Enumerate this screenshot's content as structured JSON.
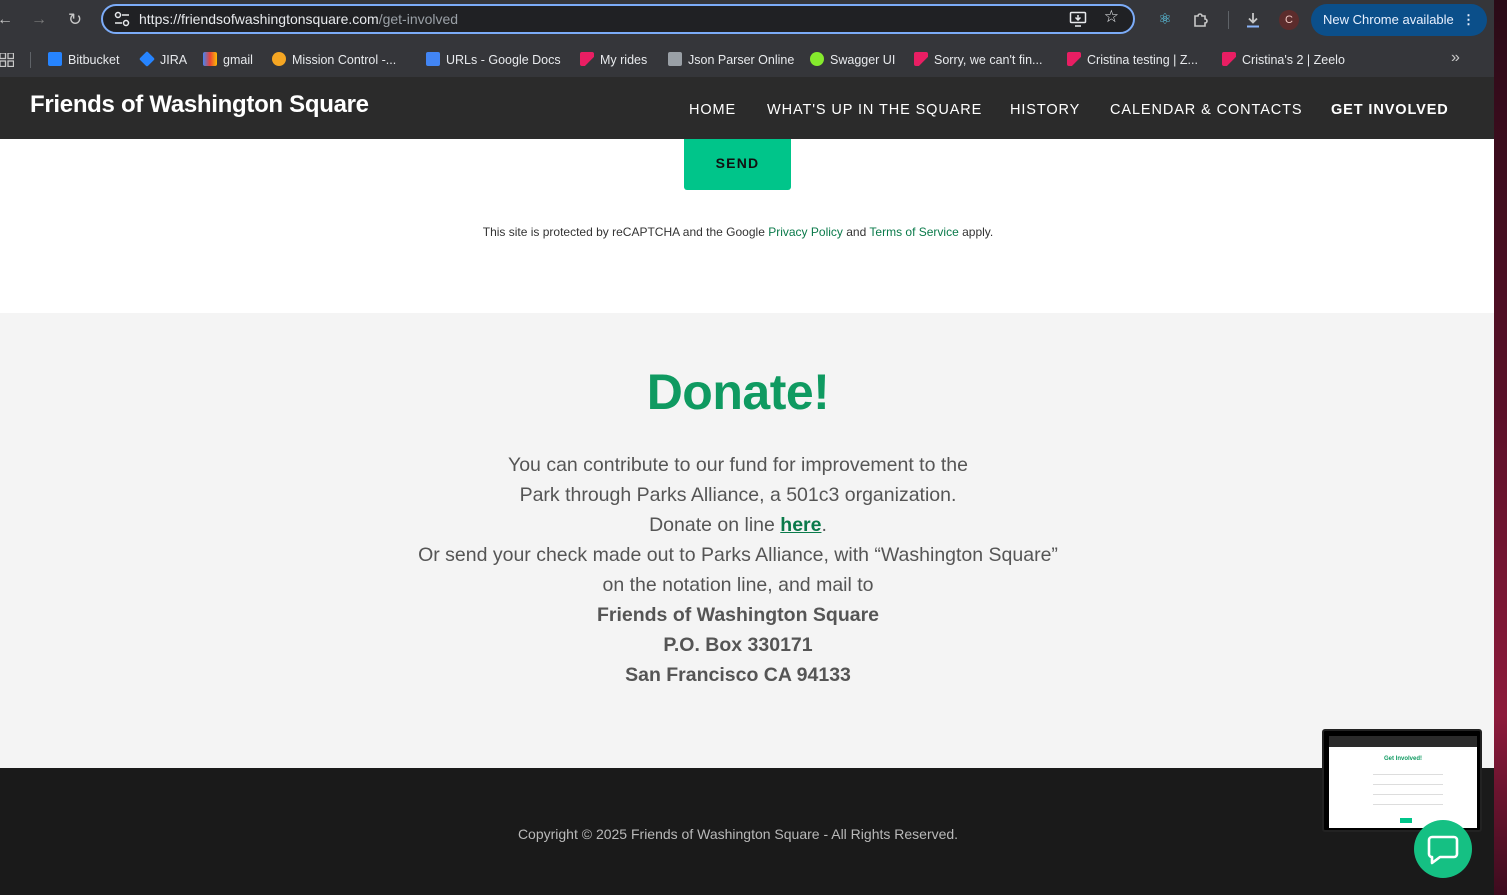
{
  "browser": {
    "url_host": "https://friendsofwashingtonsquare.com",
    "url_path": "/get-involved",
    "profile_initial": "C",
    "update_label": "New Chrome available",
    "bookmarks": [
      {
        "label": "Bitbucket",
        "color": "#2684ff"
      },
      {
        "label": "JIRA",
        "color": "#2684ff"
      },
      {
        "label": "gmail",
        "color": "#ea4335"
      },
      {
        "label": "Mission Control -...",
        "color": "#f5a623"
      },
      {
        "label": "URLs - Google Docs",
        "color": "#4285f4"
      },
      {
        "label": "My rides",
        "color": "#e91e63"
      },
      {
        "label": "Json Parser Online",
        "color": "#9aa0a6"
      },
      {
        "label": "Swagger UI",
        "color": "#85ea2d"
      },
      {
        "label": "Sorry, we can't fin...",
        "color": "#e91e63"
      },
      {
        "label": "Cristina testing | Z...",
        "color": "#e91e63"
      },
      {
        "label": "Cristina's 2 | Zeelo",
        "color": "#e91e63"
      }
    ]
  },
  "site": {
    "logo": "Friends of Washington Square",
    "nav": [
      "HOME",
      "WHAT'S UP IN THE SQUARE",
      "HISTORY",
      "CALENDAR & CONTACTS",
      "GET INVOLVED"
    ],
    "send_label": "SEND",
    "recaptcha": {
      "prefix": "This site is protected by reCAPTCHA and the Google",
      "privacy": "Privacy Policy",
      "and": "and",
      "terms": "Terms of Service",
      "suffix": "apply."
    },
    "donate": {
      "title": "Donate!",
      "line1": "You can contribute to our fund for improvement to the",
      "line2": "Park through Parks Alliance, a 501c3 organization.",
      "line3_prefix": "Donate on line",
      "line3_link": "here",
      "line3_suffix": ".",
      "line4": "Or send your check made out to Parks Alliance, with “Washington Square”",
      "line5": "on the notation line, and mail to",
      "addr1": "Friends of Washington Square",
      "addr2": "P.O. Box 330171",
      "addr3": "San Francisco CA 94133"
    },
    "copyright": "Copyright © 2025 Friends of Washington Square - All Rights Reserved.",
    "thumb_title": "Get Involved!"
  },
  "colors": {
    "accent_green": "#00c58a",
    "title_green": "#0f9a61",
    "link_green": "#0a7a4a"
  }
}
